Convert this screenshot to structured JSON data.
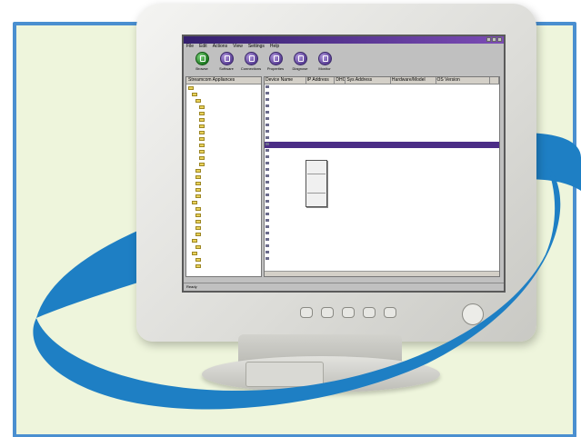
{
  "window": {
    "title": "",
    "menu": [
      "File",
      "Edit",
      "Actions",
      "View",
      "Settings",
      "Help"
    ]
  },
  "toolbar": [
    {
      "label": "Browse",
      "icon": "browse-icon"
    },
    {
      "label": "Software",
      "icon": "software-icon"
    },
    {
      "label": "Connections",
      "icon": "connections-icon"
    },
    {
      "label": "Properties",
      "icon": "properties-icon"
    },
    {
      "label": "Diagnose",
      "icon": "diagnose-icon"
    },
    {
      "label": "Monitor",
      "icon": "monitor-icon"
    }
  ],
  "tree": {
    "header": "Streamcom Appliances",
    "items": [
      "",
      "",
      "",
      "",
      "",
      "",
      "",
      "",
      "",
      "",
      "",
      "",
      "",
      "",
      "",
      "",
      "",
      "",
      "",
      "",
      "",
      "",
      "",
      "",
      "",
      "",
      "",
      "",
      ""
    ]
  },
  "list": {
    "columns": [
      "Device Name",
      "IP Address",
      "DHCP",
      "Sys Address",
      "Hardware/Model",
      "OS Version",
      ""
    ],
    "rows": [
      [
        "",
        "",
        "",
        "",
        "",
        "",
        ""
      ],
      [
        "",
        "",
        "",
        "",
        "",
        "",
        ""
      ],
      [
        "",
        "",
        "",
        "",
        "",
        "",
        ""
      ],
      [
        "",
        "",
        "",
        "",
        "",
        "",
        ""
      ],
      [
        "",
        "",
        "",
        "",
        "",
        "",
        ""
      ],
      [
        "",
        "",
        "",
        "",
        "",
        "",
        ""
      ],
      [
        "",
        "",
        "",
        "",
        "",
        "",
        ""
      ],
      [
        "",
        "",
        "",
        "",
        "",
        "",
        ""
      ],
      [
        "",
        "",
        "",
        "",
        "",
        "",
        ""
      ],
      [
        "",
        "",
        "",
        "",
        "",
        "",
        ""
      ],
      [
        "",
        "",
        "",
        "",
        "",
        "",
        ""
      ],
      [
        "",
        "",
        "",
        "",
        "",
        "",
        ""
      ],
      [
        "",
        "",
        "",
        "",
        "",
        "",
        ""
      ],
      [
        "",
        "",
        "",
        "",
        "",
        "",
        ""
      ],
      [
        "",
        "",
        "",
        "",
        "",
        "",
        ""
      ],
      [
        "",
        "",
        "",
        "",
        "",
        "",
        ""
      ],
      [
        "",
        "",
        "",
        "",
        "",
        "",
        ""
      ],
      [
        "",
        "",
        "",
        "",
        "",
        "",
        ""
      ],
      [
        "",
        "",
        "",
        "",
        "",
        "",
        ""
      ],
      [
        "",
        "",
        "",
        "",
        "",
        "",
        ""
      ],
      [
        "",
        "",
        "",
        "",
        "",
        "",
        ""
      ],
      [
        "",
        "",
        "",
        "",
        "",
        "",
        ""
      ],
      [
        "",
        "",
        "",
        "",
        "",
        "",
        ""
      ],
      [
        "",
        "",
        "",
        "",
        "",
        "",
        ""
      ],
      [
        "",
        "",
        "",
        "",
        "",
        "",
        ""
      ],
      [
        "",
        "",
        "",
        "",
        "",
        "",
        ""
      ],
      [
        "",
        "",
        "",
        "",
        "",
        "",
        ""
      ],
      [
        "",
        "",
        "",
        "",
        "",
        "",
        ""
      ]
    ],
    "selected_index": 9
  },
  "context_menu": {
    "items": [
      "",
      "",
      "",
      "",
      "",
      "",
      ""
    ]
  },
  "status": {
    "left": "Ready",
    "middle": "",
    "right": ""
  },
  "colors": {
    "frame": "#4a8fd0",
    "swoosh": "#1e7fc4",
    "panel": "#eef5dc",
    "titlebar": "#4b2d86"
  }
}
